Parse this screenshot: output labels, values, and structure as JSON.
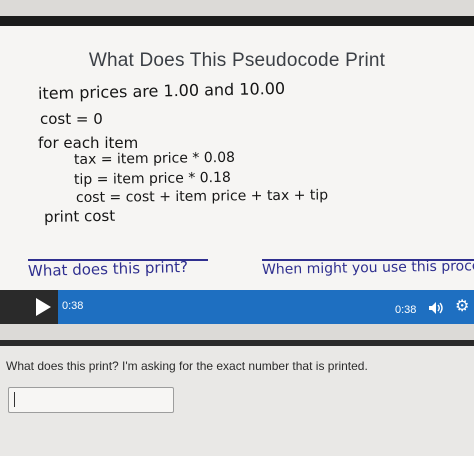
{
  "slide": {
    "title": "What Does This Pseudocode Print",
    "code_lines": [
      "item prices are 1.00 and 10.00",
      "cost = 0",
      "for each item",
      "tax = item price * 0.08",
      "tip = item price * 0.18",
      "cost = cost + item price + tax + tip",
      "print cost"
    ],
    "prompt_left": "What does this print?",
    "prompt_right": "When might you use this proces"
  },
  "player": {
    "elapsed": "0:38",
    "duration": "0:38",
    "progress": 1.0,
    "icons": [
      "play-icon",
      "volume-icon",
      "gear-icon"
    ],
    "accent_color": "#1e6fc1"
  },
  "question": {
    "text": "What does this print? I'm asking for the exact number that is printed.",
    "answer_value": ""
  }
}
